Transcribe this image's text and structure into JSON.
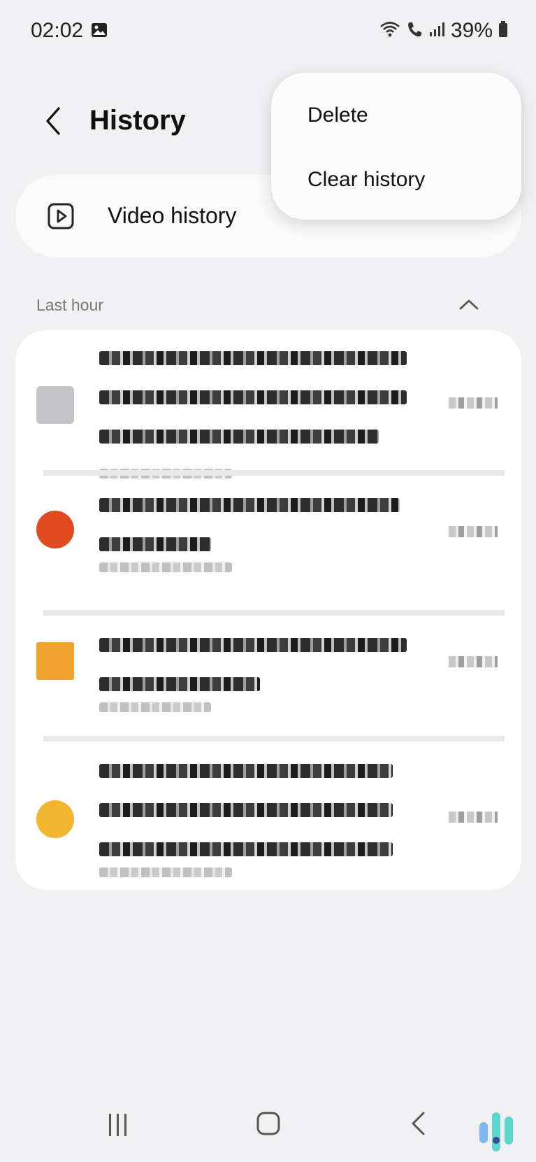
{
  "status_bar": {
    "time": "02:02",
    "battery": "39%"
  },
  "header": {
    "title": "History"
  },
  "video_history": {
    "label": "Video history"
  },
  "section": {
    "label": "Last hour"
  },
  "menu": {
    "items": [
      "Delete",
      "Clear history"
    ]
  },
  "history_items": [
    {
      "thumb_color": "#c4c4c8",
      "lines": 3
    },
    {
      "thumb_color": "#e04a1f",
      "lines": 2
    },
    {
      "thumb_color": "#f0a32c",
      "lines": 2
    },
    {
      "thumb_color": "#f3b430",
      "lines": 3
    }
  ],
  "colors": {
    "background": "#f1f1f4",
    "card": "#ffffff",
    "accent_brand": "#5dd6cf"
  },
  "icons": [
    "gallery-icon",
    "wifi-icon",
    "call-icon",
    "signal-icon",
    "battery-icon",
    "back-arrow-icon",
    "play-icon",
    "chevron-up-icon",
    "recent-apps-icon",
    "home-icon",
    "nav-back-icon"
  ]
}
